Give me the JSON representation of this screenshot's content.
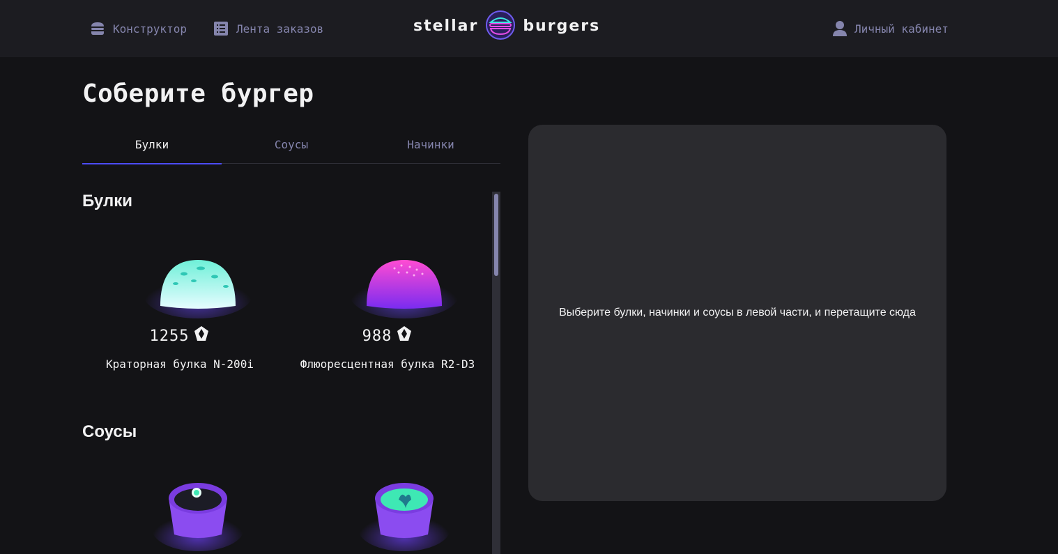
{
  "header": {
    "nav": {
      "constructor": "Конструктор",
      "order_feed": "Лента заказов",
      "profile": "Личный кабинет"
    },
    "logo": {
      "left": "stellar",
      "right": "burgers"
    }
  },
  "page_title": "Соберите бургер",
  "tabs": [
    {
      "label": "Булки",
      "active": true
    },
    {
      "label": "Соусы",
      "active": false
    },
    {
      "label": "Начинки",
      "active": false
    }
  ],
  "sections": {
    "buns": {
      "title": "Булки",
      "items": [
        {
          "price": "1255",
          "name": "Краторная булка N-200i",
          "color": "#7ff5e6",
          "icon": "bun-image"
        },
        {
          "price": "988",
          "name": "Флюоресцентная булка R2-D3",
          "color": "#e44ce8",
          "icon": "bun-image"
        }
      ]
    },
    "sauces": {
      "title": "Соусы",
      "items": [
        {
          "icon": "sauce-image",
          "color": "#8b4cf0"
        },
        {
          "icon": "sauce-image",
          "color": "#3ee8b4"
        }
      ]
    }
  },
  "constructor": {
    "placeholder": "Выберите булки, начинки и соусы в левой части, и перетащите сюда"
  },
  "colors": {
    "background": "#131316",
    "header": "#1c1c21",
    "panel": "#2b2b2f",
    "accent": "#4c4cff",
    "muted": "#8585ad"
  }
}
